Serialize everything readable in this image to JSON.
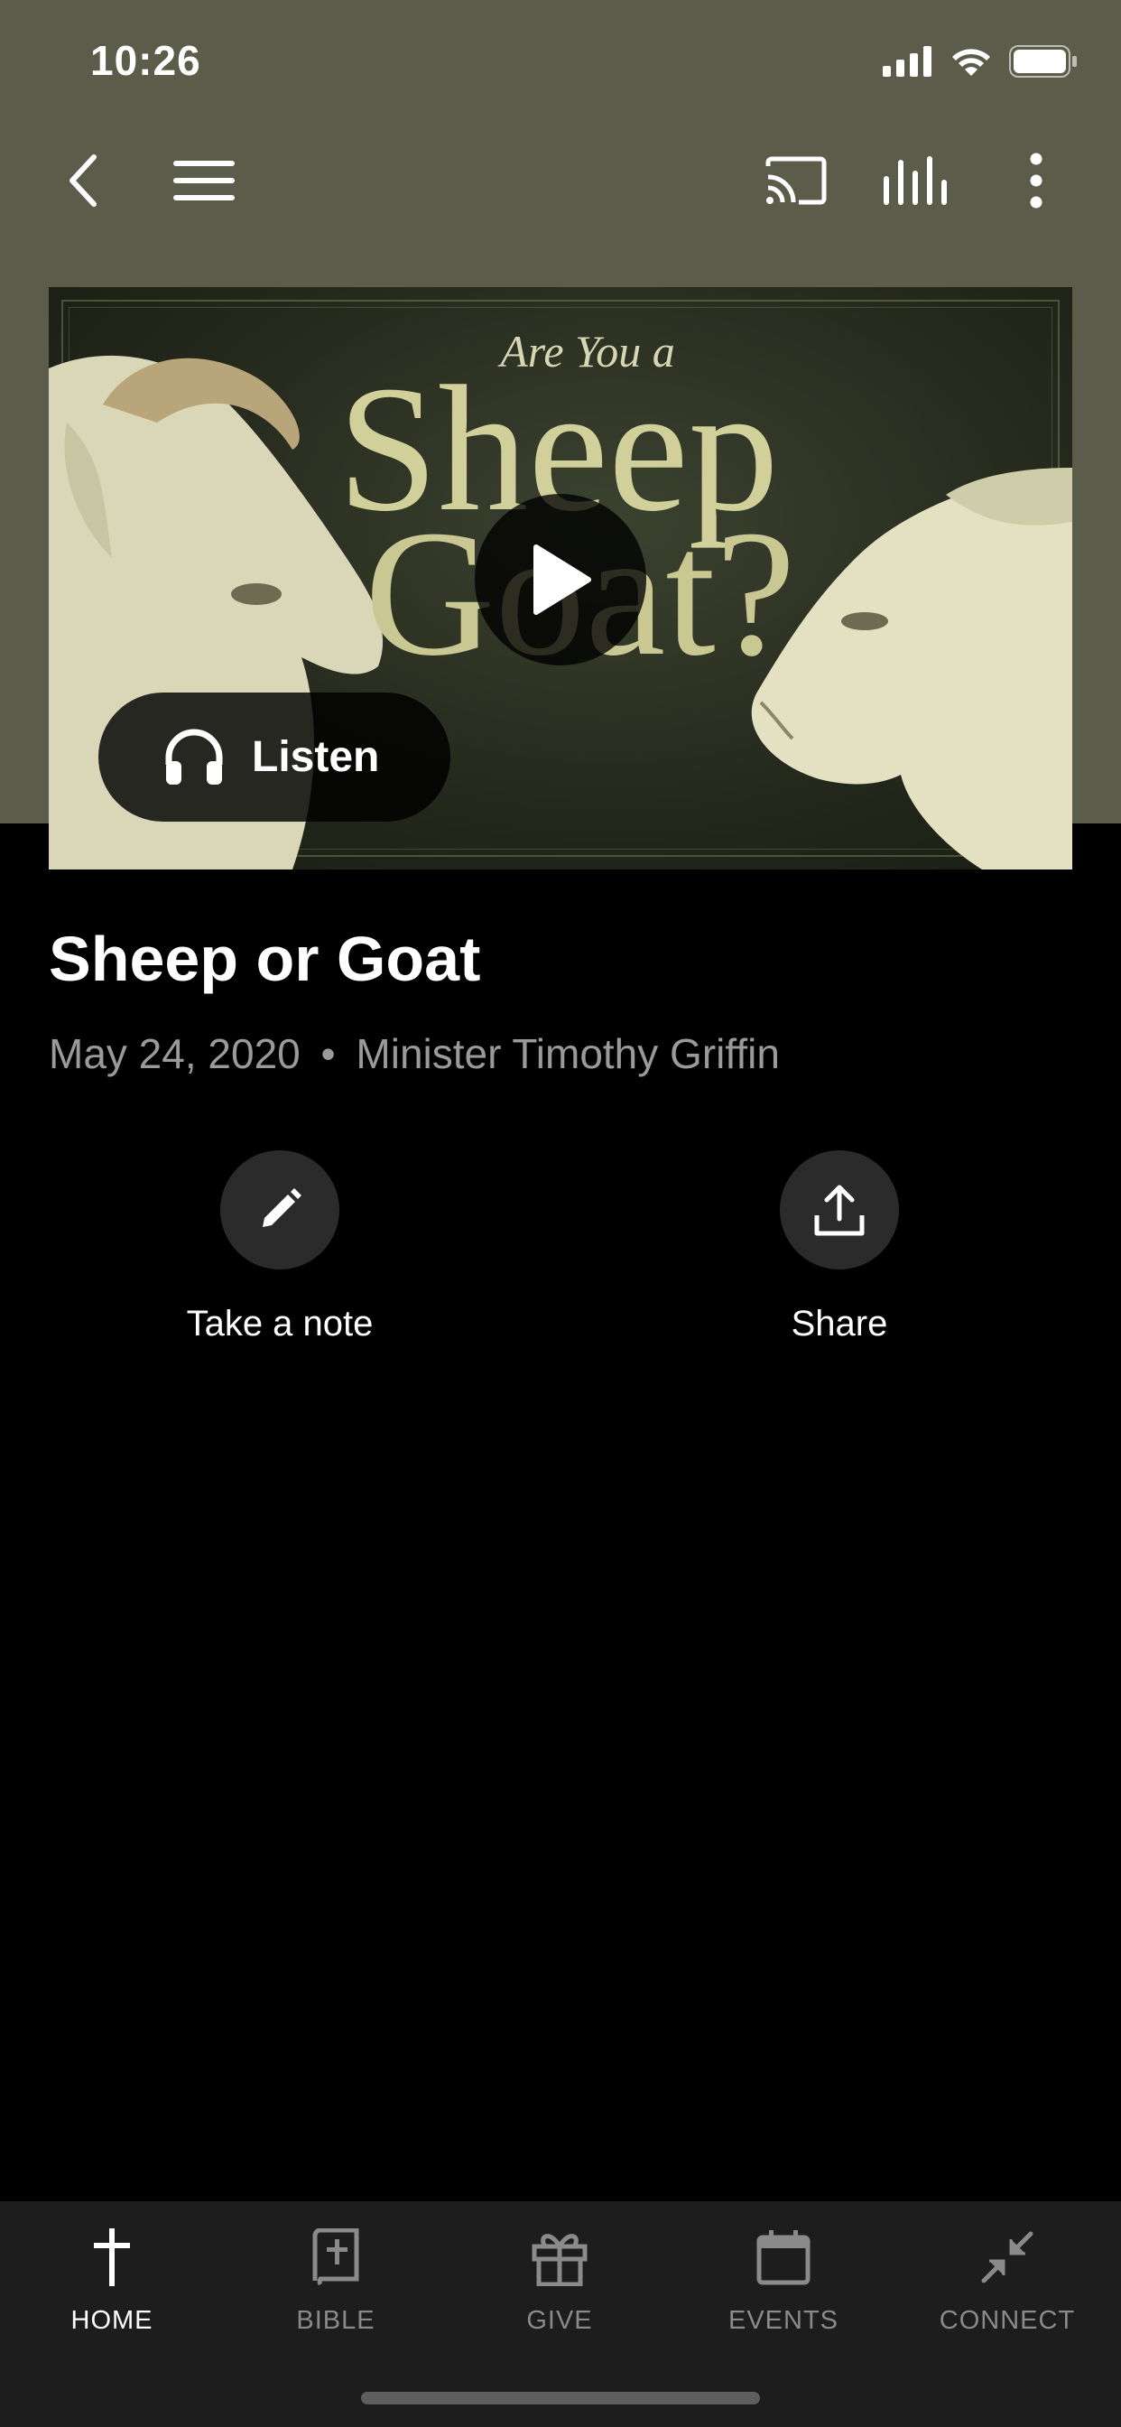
{
  "status_bar": {
    "time": "10:26"
  },
  "toolbar": {
    "back_icon": "chevron-left-icon",
    "menu_icon": "hamburger-icon",
    "cast_icon": "cast-icon",
    "audio_icon": "equalizer-icon",
    "more_icon": "more-vertical-icon"
  },
  "hero": {
    "artwork_text": {
      "line1": "Are You a",
      "line2": "Sheep",
      "line3": "Goat?"
    },
    "listen_label": "Listen"
  },
  "sermon": {
    "title": "Sheep or Goat",
    "date": "May 24, 2020",
    "separator": "•",
    "speaker": "Minister Timothy Griffin"
  },
  "actions": [
    {
      "label": "Take a note",
      "icon": "pencil-icon"
    },
    {
      "label": "Share",
      "icon": "share-upload-icon"
    }
  ],
  "tabs": [
    {
      "label": "HOME",
      "icon": "cross-icon",
      "active": true
    },
    {
      "label": "BIBLE",
      "icon": "bible-icon",
      "active": false
    },
    {
      "label": "GIVE",
      "icon": "gift-icon",
      "active": false
    },
    {
      "label": "EVENTS",
      "icon": "calendar-icon",
      "active": false
    },
    {
      "label": "CONNECT",
      "icon": "connect-arrows-icon",
      "active": false
    }
  ],
  "colors": {
    "header_bg": "#5b5c4a",
    "page_bg": "#000000",
    "tab_bar_bg": "#1d1d1d",
    "meta_text": "#9a9a9a",
    "action_circle": "#2b2b2b"
  }
}
